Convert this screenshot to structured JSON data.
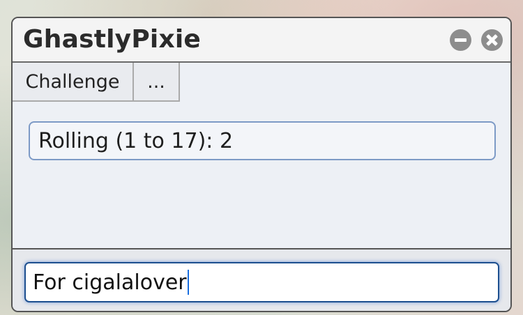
{
  "window": {
    "title": "GhastlyPixie",
    "controls": [
      "minimize-icon",
      "close-icon"
    ]
  },
  "tabs": [
    {
      "label": "Challenge"
    },
    {
      "label": "..."
    }
  ],
  "roll": {
    "text": "Rolling (1 to 17): 2"
  },
  "message_input": {
    "value": "For cigalalover"
  },
  "colors": {
    "window_bg": "#eef0f4",
    "border": "#555555",
    "roll_border": "#7d9ac6",
    "input_border": "#1d4f8f",
    "caret": "#1a6fe0",
    "control_buttons": "#8d8d8d"
  }
}
